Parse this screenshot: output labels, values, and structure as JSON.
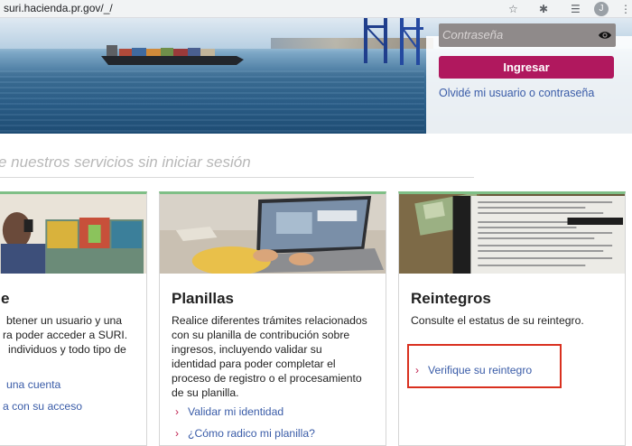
{
  "browser": {
    "url": "suri.hacienda.pr.gov/_/",
    "star_icon": "star-icon",
    "extensions_icon": "puzzle-icon",
    "reading_list_icon": "list-icon",
    "avatar_letter": "J",
    "menu_icon": "kebab-menu-icon"
  },
  "login": {
    "password_placeholder": "Contraseña",
    "login_button": "Ingresar",
    "forgot_link": "Olvidé mi usuario o contraseña",
    "accent_color": "#b0185e"
  },
  "services_heading": "e nuestros servicios sin iniciar sesión",
  "cards": [
    {
      "title": "e",
      "desc_lines": [
        "btener un usuario y una",
        "ra poder acceder a SURI.",
        "individuos y todo tipo de"
      ],
      "links": [
        "una cuenta",
        "a con su acceso"
      ]
    },
    {
      "title": "Planillas",
      "desc_lines": [
        "Realice diferentes trámites relacionados",
        "con su planilla de contribución sobre",
        "ingresos, incluyendo validar su",
        "identidad para poder completar el",
        "proceso de registro o el procesamiento",
        "de su planilla."
      ],
      "links": [
        "Validar mi identidad",
        "¿Cómo radico mi planilla?"
      ]
    },
    {
      "title": "Reintegros",
      "desc_lines": [
        "Consulte el estatus de su reintegro."
      ],
      "links": [
        "Verifique su reintegro"
      ]
    }
  ],
  "colors": {
    "link": "#3a5ca8",
    "chevron": "#c0204f",
    "card_top_border": "#7fbf86",
    "highlight": "#d9301f"
  }
}
